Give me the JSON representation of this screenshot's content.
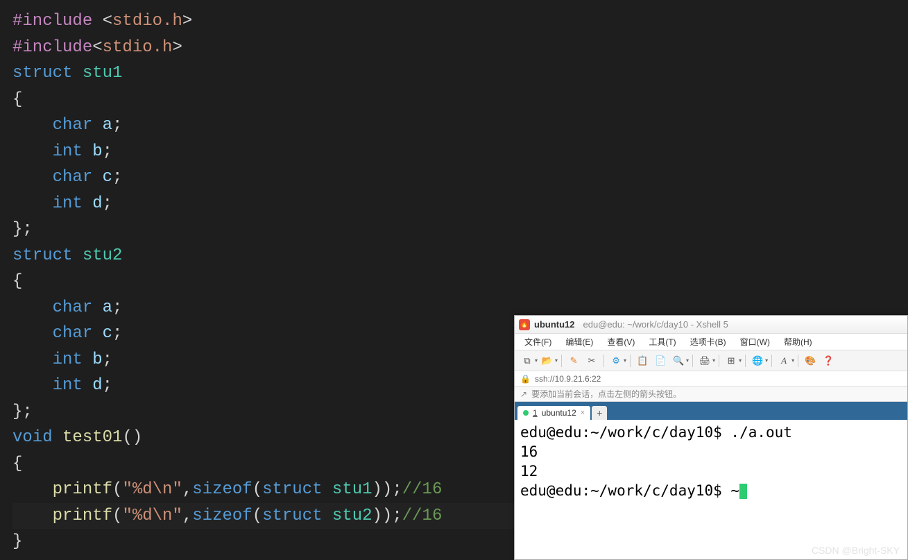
{
  "editor": {
    "lines": [
      {
        "html": "<span class='kw-include'>#include</span> <span class='kw-angle'>&lt;</span><span class='kw-header'>stdio.h</span><span class='kw-angle'>&gt;</span>"
      },
      {
        "html": "<span class='kw-include'>#include</span><span class='kw-angle'>&lt;</span><span class='kw-header'>stdio.h</span><span class='kw-angle'>&gt;</span>"
      },
      {
        "html": "<span class='kw-struct'>struct</span> <span class='kw-name'>stu1</span>"
      },
      {
        "html": "<span class='kw-punc'>{</span>"
      },
      {
        "indent": 1,
        "html": "<span class='kw-type'>char</span> <span class='kw-var'>a</span><span class='kw-punc'>;</span>"
      },
      {
        "indent": 1,
        "html": "<span class='kw-type'>int</span> <span class='kw-var'>b</span><span class='kw-punc'>;</span>"
      },
      {
        "indent": 1,
        "html": "<span class='kw-type'>char</span> <span class='kw-var'>c</span><span class='kw-punc'>;</span>"
      },
      {
        "indent": 1,
        "html": "<span class='kw-type'>int</span> <span class='kw-var'>d</span><span class='kw-punc'>;</span>"
      },
      {
        "html": "<span class='kw-punc'>};</span>"
      },
      {
        "html": "<span class='kw-struct'>struct</span> <span class='kw-name'>stu2</span>"
      },
      {
        "html": "<span class='kw-punc'>{</span>"
      },
      {
        "indent": 1,
        "html": "<span class='kw-type'>char</span> <span class='kw-var'>a</span><span class='kw-punc'>;</span>"
      },
      {
        "indent": 1,
        "html": "<span class='kw-type'>char</span> <span class='kw-var'>c</span><span class='kw-punc'>;</span>"
      },
      {
        "indent": 1,
        "html": "<span class='kw-type'>int</span> <span class='kw-var'>b</span><span class='kw-punc'>;</span>"
      },
      {
        "indent": 1,
        "html": "<span class='kw-type'>int</span> <span class='kw-var'>d</span><span class='kw-punc'>;</span>"
      },
      {
        "html": "<span class='kw-punc'>};</span>"
      },
      {
        "html": "<span class='kw-void'>void</span> <span class='kw-func'>test01</span><span class='kw-punc'>()</span>"
      },
      {
        "html": "<span class='kw-punc'>{</span>"
      },
      {
        "indent": 1,
        "html": "<span class='kw-func'>printf</span><span class='kw-punc'>(</span><span class='kw-str'>\"%d\\n\"</span><span class='kw-punc'>,</span><span class='kw-sizeof'>sizeof</span><span class='kw-punc'>(</span><span class='kw-struct'>struct</span> <span class='kw-name'>stu1</span><span class='kw-punc'>));</span><span class='kw-comment'>//16</span>"
      },
      {
        "indent": 1,
        "highlight": true,
        "html": "<span class='kw-func'>printf</span><span class='kw-punc'>(</span><span class='kw-str'>\"%d\\n\"</span><span class='kw-punc'>,</span><span class='kw-sizeof'>sizeof</span><span class='kw-punc'>(</span><span class='kw-struct'>struct</span> <span class='kw-name'>stu2</span><span class='kw-punc'>));</span><span class='kw-comment'>//16</span>"
      },
      {
        "html": "<span class='kw-punc'>}</span>"
      }
    ]
  },
  "xshell": {
    "app_icon": "🔥",
    "title": "ubuntu12",
    "subtitle": "edu@edu: ~/work/c/day10 - Xshell 5",
    "menus": [
      "文件(F)",
      "编辑(E)",
      "查看(V)",
      "工具(T)",
      "选项卡(B)",
      "窗口(W)",
      "帮助(H)"
    ],
    "address_icon": "🔒",
    "address": "ssh://10.9.21.6:22",
    "hint_icon": "↗",
    "hint": "要添加当前会话，点击左侧的箭头按钮。",
    "tab": {
      "num": "1",
      "label": "ubuntu12"
    },
    "term_lines": [
      "edu@edu:~/work/c/day10$ ./a.out",
      "16",
      "12",
      "edu@edu:~/work/c/day10$ ~"
    ]
  },
  "watermark": "CSDN @Bright-SKY"
}
